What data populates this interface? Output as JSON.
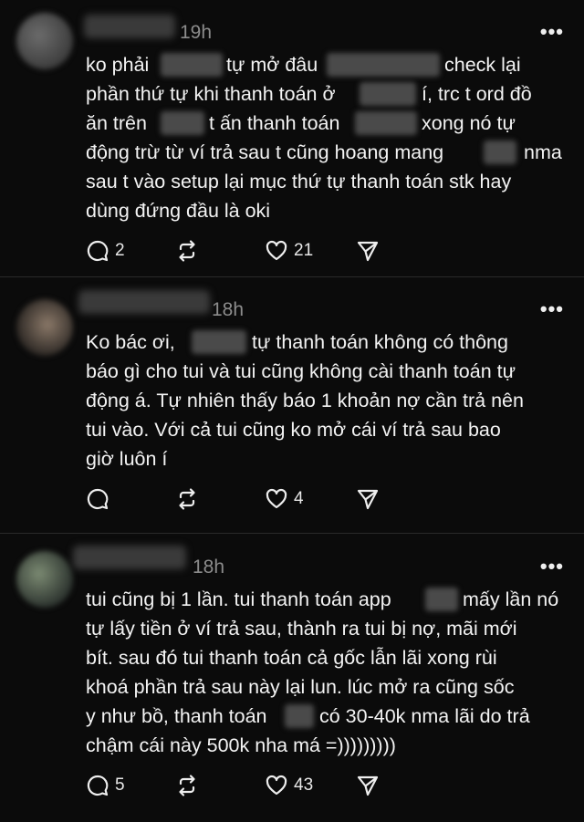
{
  "posts": [
    {
      "time": "19h",
      "lines": [
        {
          "segments": [
            "ko phải",
            "tự mở đâu",
            "check lại"
          ]
        },
        {
          "segments": [
            "phần thứ tự khi thanh toán ở",
            "í, trc t ord đồ"
          ]
        },
        {
          "segments": [
            "ăn trên",
            "t ấn thanh toán",
            "xong nó tự"
          ]
        },
        {
          "segments": [
            "động trừ từ ví trả sau t cũng hoang mang",
            "nma"
          ]
        },
        {
          "segments": [
            "sau t vào setup lại mục thứ tự thanh toán stk hay"
          ]
        },
        {
          "segments": [
            "dùng đứng đầu là oki"
          ]
        }
      ],
      "reply_count": "2",
      "like_count": "21"
    },
    {
      "time": "18h",
      "lines": [
        {
          "segments": [
            "Ko bác ơi,",
            "tự thanh toán không có thông"
          ]
        },
        {
          "segments": [
            "báo gì cho tui và tui cũng không cài thanh toán tự"
          ]
        },
        {
          "segments": [
            "động á. Tự nhiên thấy báo 1 khoản nợ cần trả nên"
          ]
        },
        {
          "segments": [
            "tui vào. Với cả tui cũng ko mở cái ví trả sau bao"
          ]
        },
        {
          "segments": [
            "giờ luôn í"
          ]
        }
      ],
      "reply_count": "",
      "like_count": "4"
    },
    {
      "time": "18h",
      "lines": [
        {
          "segments": [
            "tui cũng bị 1 lần. tui thanh toán app",
            "mấy lần nó"
          ]
        },
        {
          "segments": [
            "tự lấy tiền ở ví trả sau, thành ra tui bị nợ, mãi mới"
          ]
        },
        {
          "segments": [
            "bít. sau đó tui thanh toán cả gốc lẫn lãi xong rùi"
          ]
        },
        {
          "segments": [
            "khoá phần trả sau này lại lun. lúc mở ra cũng sốc"
          ]
        },
        {
          "segments": [
            "y như bồ, thanh toán",
            "có 30-40k nma lãi do trả"
          ]
        },
        {
          "segments": [
            "chậm cái này 500k nha má =)))))))))"
          ]
        }
      ],
      "reply_count": "5",
      "like_count": "43"
    }
  ],
  "more_label": "•••",
  "colors": {
    "background": "#0b0b0b",
    "text": "#f3f3f3",
    "muted": "#8c8c8c"
  }
}
